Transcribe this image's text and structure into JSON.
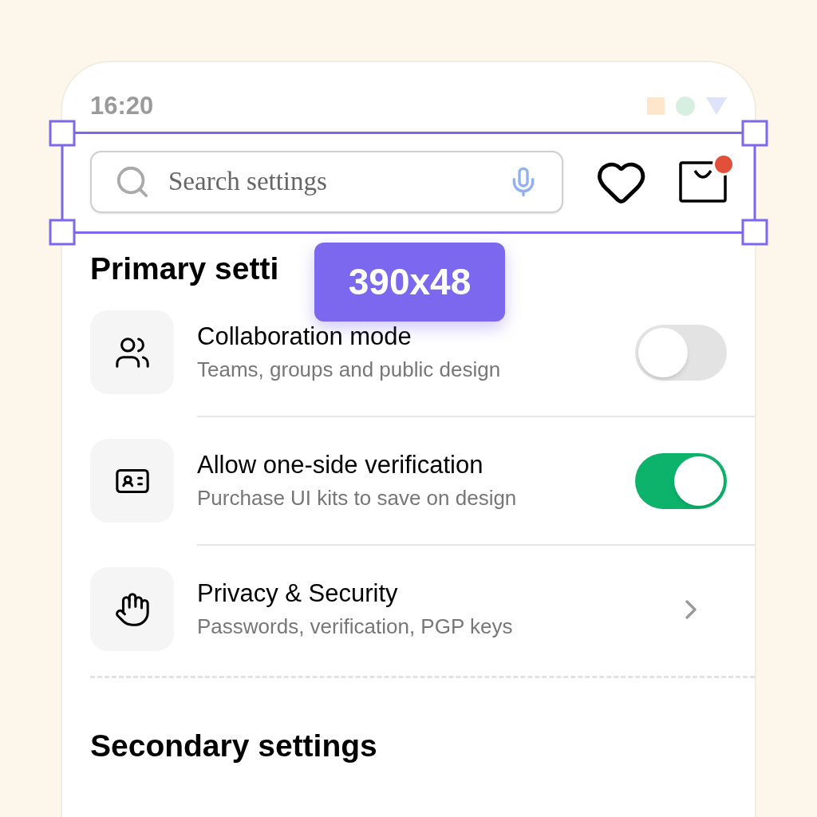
{
  "status_bar": {
    "time": "16:20"
  },
  "search": {
    "placeholder": "Search settings"
  },
  "cart": {
    "has_notification": true
  },
  "selection": {
    "label": "390x48"
  },
  "primary_section": {
    "title": "Primary setti",
    "items": [
      {
        "kind": "toggle",
        "title": "Collaboration mode",
        "subtitle": "Teams, groups and public design",
        "on": false
      },
      {
        "kind": "toggle",
        "title": "Allow one-side verification",
        "subtitle": "Purchase UI kits to save on design",
        "on": true
      },
      {
        "kind": "link",
        "title": "Privacy & Security",
        "subtitle": "Passwords, verification, PGP keys"
      }
    ]
  },
  "secondary_section": {
    "title": "Secondary settings"
  }
}
